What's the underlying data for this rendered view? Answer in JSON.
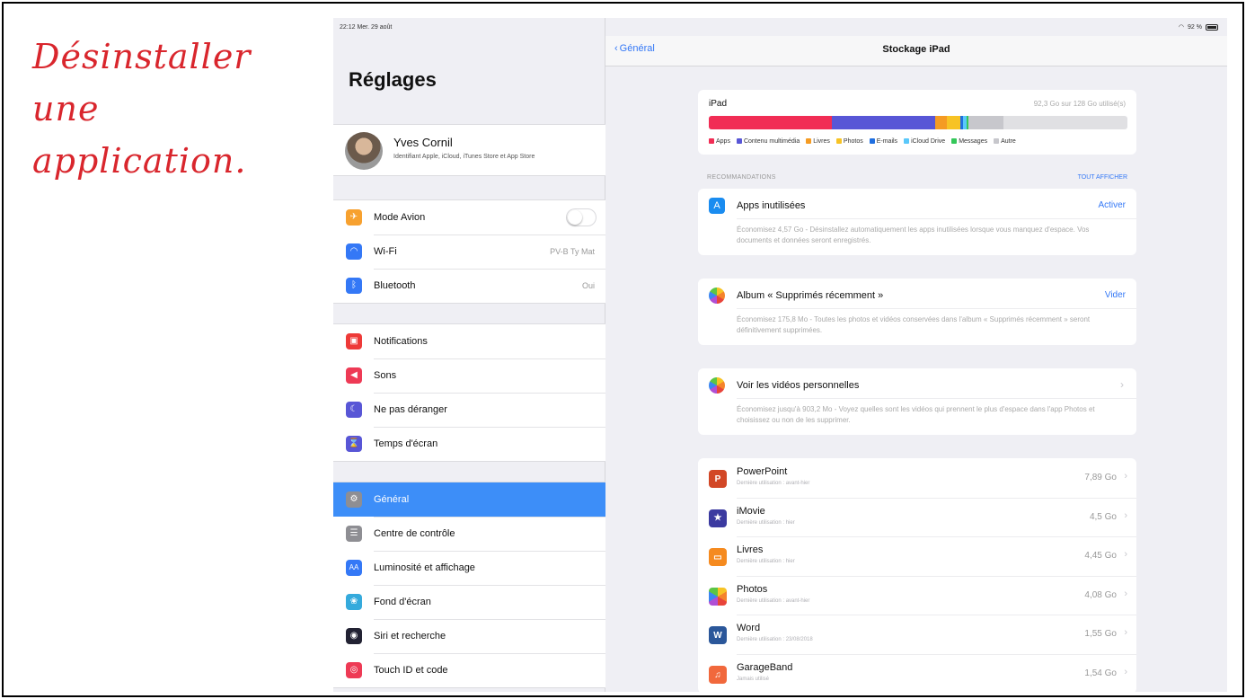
{
  "caption": {
    "lines": [
      "Désinstaller",
      "une",
      "application."
    ]
  },
  "status": {
    "time": "22:12  Mer. 29 août",
    "battery": "92 %"
  },
  "sidebar": {
    "title": "Réglages",
    "profile": {
      "name": "Yves Cornil",
      "subtitle": "Identifiant Apple, iCloud, iTunes Store et App Store"
    },
    "group1": [
      {
        "label": "Mode Avion",
        "value": "",
        "icon": "airplane-icon",
        "color": "#f7a12f"
      },
      {
        "label": "Wi-Fi",
        "value": "PV-B Ty Mat",
        "icon": "wifi-icon",
        "color": "#3478f6"
      },
      {
        "label": "Bluetooth",
        "value": "Oui",
        "icon": "bluetooth-icon",
        "color": "#3478f6"
      }
    ],
    "group2": [
      {
        "label": "Notifications",
        "icon": "notifications-icon",
        "color": "#ee3a38"
      },
      {
        "label": "Sons",
        "icon": "sound-icon",
        "color": "#ee3a55"
      },
      {
        "label": "Ne pas déranger",
        "icon": "moon-icon",
        "color": "#5856d6"
      },
      {
        "label": "Temps d'écran",
        "icon": "hourglass-icon",
        "color": "#5856d6"
      }
    ],
    "group3": [
      {
        "label": "Général",
        "icon": "gear-icon",
        "color": "#8e8e93",
        "selected": true
      },
      {
        "label": "Centre de contrôle",
        "icon": "control-center-icon",
        "color": "#8e8e93"
      },
      {
        "label": "Luminosité et affichage",
        "icon": "brightness-icon",
        "color": "#3478f6"
      },
      {
        "label": "Fond d'écran",
        "icon": "wallpaper-icon",
        "color": "#35aadc"
      },
      {
        "label": "Siri et recherche",
        "icon": "siri-icon",
        "color": "#222233"
      },
      {
        "label": "Touch ID et code",
        "icon": "fingerprint-icon",
        "color": "#ee3a55"
      }
    ]
  },
  "nav": {
    "back": "Général",
    "title": "Stockage iPad"
  },
  "storage": {
    "device": "iPad",
    "used": "92,3 Go sur 128 Go utilisé(s)",
    "used_fraction": 0.721,
    "segments": [
      {
        "name": "Apps",
        "fraction": 0.295,
        "color": "#f12d55"
      },
      {
        "name": "Contenu multimédia",
        "fraction": 0.245,
        "color": "#5856d6"
      },
      {
        "name": "Livres",
        "fraction": 0.028,
        "color": "#f59b23"
      },
      {
        "name": "Photos",
        "fraction": 0.032,
        "color": "#f7c325"
      },
      {
        "name": "E-mails",
        "fraction": 0.008,
        "color": "#1f6fe0"
      },
      {
        "name": "iCloud Drive",
        "fraction": 0.008,
        "color": "#5ac8fa"
      },
      {
        "name": "Messages",
        "fraction": 0.004,
        "color": "#34c759"
      },
      {
        "name": "Autre",
        "fraction": 0.085,
        "color": "#c7c7cc"
      }
    ]
  },
  "recommendations": {
    "header": "RECOMMANDATIONS",
    "show_all": "TOUT AFFICHER",
    "items": [
      {
        "title": "Apps inutilisées",
        "action": "Activer",
        "icon": "app-store-icon",
        "desc": "Économisez 4,57 Go - Désinstallez automatiquement les apps inutilisées lorsque vous manquez d'espace. Vos documents et données seront enregistrés."
      },
      {
        "title": "Album « Supprimés récemment »",
        "action": "Vider",
        "icon": "photos-icon",
        "desc": "Économisez 175,8 Mo - Toutes les photos et vidéos conservées dans l'album « Supprimés récemment » seront définitivement supprimées."
      },
      {
        "title": "Voir les vidéos personnelles",
        "action": "",
        "icon": "photos-icon",
        "desc": "Économisez jusqu'à 903,2 Mo - Voyez quelles sont les vidéos qui prennent le plus d'espace dans l'app Photos et choisissez ou non de les supprimer."
      }
    ]
  },
  "apps": [
    {
      "name": "PowerPoint",
      "last": "Dernière utilisation : avant-hier",
      "size": "7,89 Go",
      "icon": "powerpoint-icon",
      "color": "#d24726",
      "glyph": "P"
    },
    {
      "name": "iMovie",
      "last": "Dernière utilisation : hier",
      "size": "4,5 Go",
      "icon": "imovie-icon",
      "color": "#3b3aa0",
      "glyph": "★"
    },
    {
      "name": "Livres",
      "last": "Dernière utilisation : hier",
      "size": "4,45 Go",
      "icon": "books-icon",
      "color": "#f58a1f",
      "glyph": "▭"
    },
    {
      "name": "Photos",
      "last": "Dernière utilisation : avant-hier",
      "size": "4,08 Go",
      "icon": "photos-icon",
      "color": "",
      "glyph": ""
    },
    {
      "name": "Word",
      "last": "Dernière utilisation : 23/08/2018",
      "size": "1,55 Go",
      "icon": "word-icon",
      "color": "#2b579a",
      "glyph": "W"
    },
    {
      "name": "GarageBand",
      "last": "Jamais utilisé",
      "size": "1,54 Go",
      "icon": "garageband-icon",
      "color": "#f1683c",
      "glyph": "♫"
    }
  ]
}
